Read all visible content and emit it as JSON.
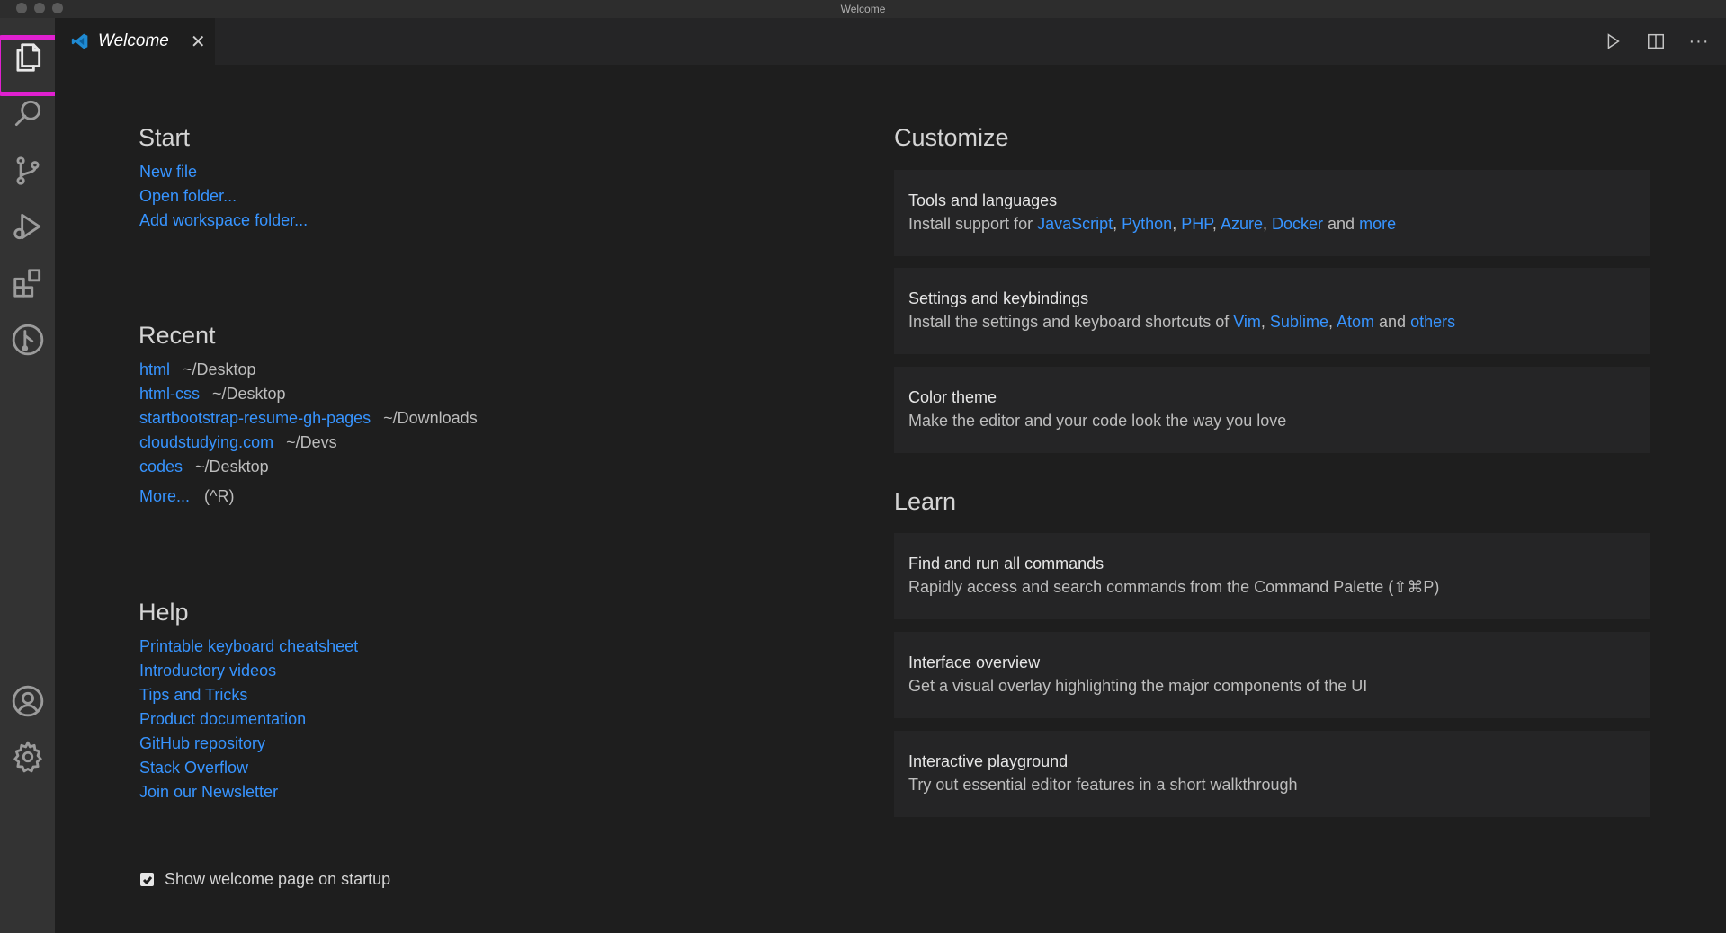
{
  "window": {
    "title": "Welcome"
  },
  "activity_bar": {
    "items": [
      "files-icon",
      "search-icon",
      "source-control-icon",
      "run-debug-icon",
      "extensions-icon",
      "git-graph-icon"
    ],
    "bottom": [
      "account-icon",
      "settings-gear-icon"
    ]
  },
  "tab": {
    "title": "Welcome",
    "close": "✕"
  },
  "tab_actions": {
    "more": "···"
  },
  "start": {
    "title": "Start",
    "links": [
      "New file",
      "Open folder...",
      "Add workspace folder..."
    ]
  },
  "recent": {
    "title": "Recent",
    "items": [
      {
        "name": "html",
        "path": "~/Desktop"
      },
      {
        "name": "html-css",
        "path": "~/Desktop"
      },
      {
        "name": "startbootstrap-resume-gh-pages",
        "path": "~/Downloads"
      },
      {
        "name": "cloudstudying.com",
        "path": "~/Devs"
      },
      {
        "name": "codes",
        "path": "~/Desktop"
      }
    ],
    "more": "More...",
    "more_shortcut": "(^R)"
  },
  "help": {
    "title": "Help",
    "links": [
      "Printable keyboard cheatsheet",
      "Introductory videos",
      "Tips and Tricks",
      "Product documentation",
      "GitHub repository",
      "Stack Overflow",
      "Join our Newsletter"
    ]
  },
  "customize": {
    "title": "Customize",
    "tools": {
      "title": "Tools and languages",
      "prefix": "Install support for",
      "links": [
        "JavaScript",
        "Python",
        "PHP",
        "Azure",
        "Docker"
      ],
      "and": "and",
      "more": "more"
    },
    "settings": {
      "title": "Settings and keybindings",
      "prefix": "Install the settings and keyboard shortcuts of",
      "links": [
        "Vim",
        "Sublime",
        "Atom"
      ],
      "and": "and",
      "others": "others"
    },
    "theme": {
      "title": "Color theme",
      "desc": "Make the editor and your code look the way you love"
    }
  },
  "learn": {
    "title": "Learn",
    "cards": [
      {
        "title": "Find and run all commands",
        "desc": "Rapidly access and search commands from the Command Palette (⇧⌘P)"
      },
      {
        "title": "Interface overview",
        "desc": "Get a visual overlay highlighting the major components of the UI"
      },
      {
        "title": "Interactive playground",
        "desc": "Try out essential editor features in a short walkthrough"
      }
    ]
  },
  "startup": {
    "label": "Show welcome page on startup",
    "checked": true
  },
  "colors": {
    "link": "#3794ff",
    "highlight": "#e020d0",
    "background": "#1e1e1e",
    "activity_bar": "#333333"
  }
}
